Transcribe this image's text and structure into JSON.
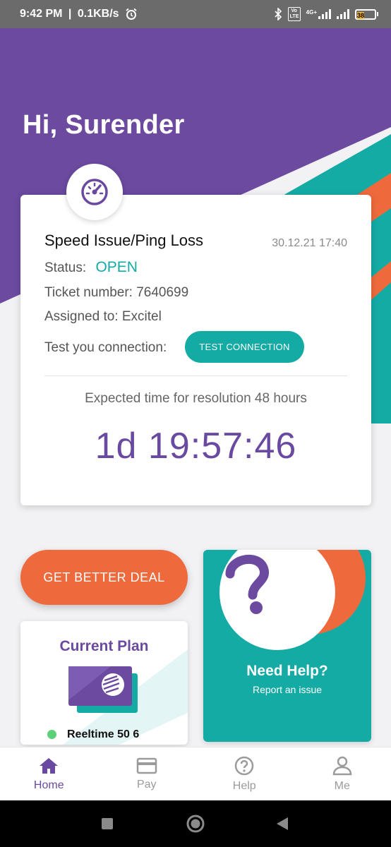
{
  "status_bar": {
    "time": "9:42 PM",
    "network_speed": "0.1KB/s",
    "alarm_icon": "alarm-icon",
    "bluetooth_icon": "bluetooth-icon",
    "volte_label": "Vo LTE",
    "network_type": "4G+",
    "battery_level": "38"
  },
  "header": {
    "greeting": "Hi, Surender",
    "colors": {
      "purple": "#6b4aa0",
      "teal": "#14aba5",
      "orange": "#ee6a3c"
    }
  },
  "ticket": {
    "icon": "speedometer-icon",
    "title": "Speed Issue/Ping Loss",
    "date": "30.12.21 17:40",
    "status_label": "Status:",
    "status_value": "OPEN",
    "ticket_number": "Ticket number: 7640699",
    "assigned_to": "Assigned to: Excitel",
    "test_label": "Test you connection:",
    "test_button": "TEST CONNECTION",
    "expected_time": "Expected time for resolution 48 hours",
    "countdown": "1d 19:57:46"
  },
  "deal_button": {
    "label": "GET BETTER DEAL"
  },
  "plan": {
    "title": "Current Plan",
    "icon": "plan-card-icon",
    "name": "Reeltime 50 6"
  },
  "help": {
    "icon": "question-mark-icon",
    "title": "Need Help?",
    "subtitle": "Report an issue"
  },
  "bottom_nav": {
    "items": [
      {
        "label": "Home",
        "icon": "home-icon",
        "active": true
      },
      {
        "label": "Pay",
        "icon": "card-icon",
        "active": false
      },
      {
        "label": "Help",
        "icon": "help-circle-icon",
        "active": false
      },
      {
        "label": "Me",
        "icon": "person-icon",
        "active": false
      }
    ]
  },
  "system_nav": {
    "icons": [
      "recents-icon",
      "home-circle-icon",
      "back-icon"
    ]
  }
}
